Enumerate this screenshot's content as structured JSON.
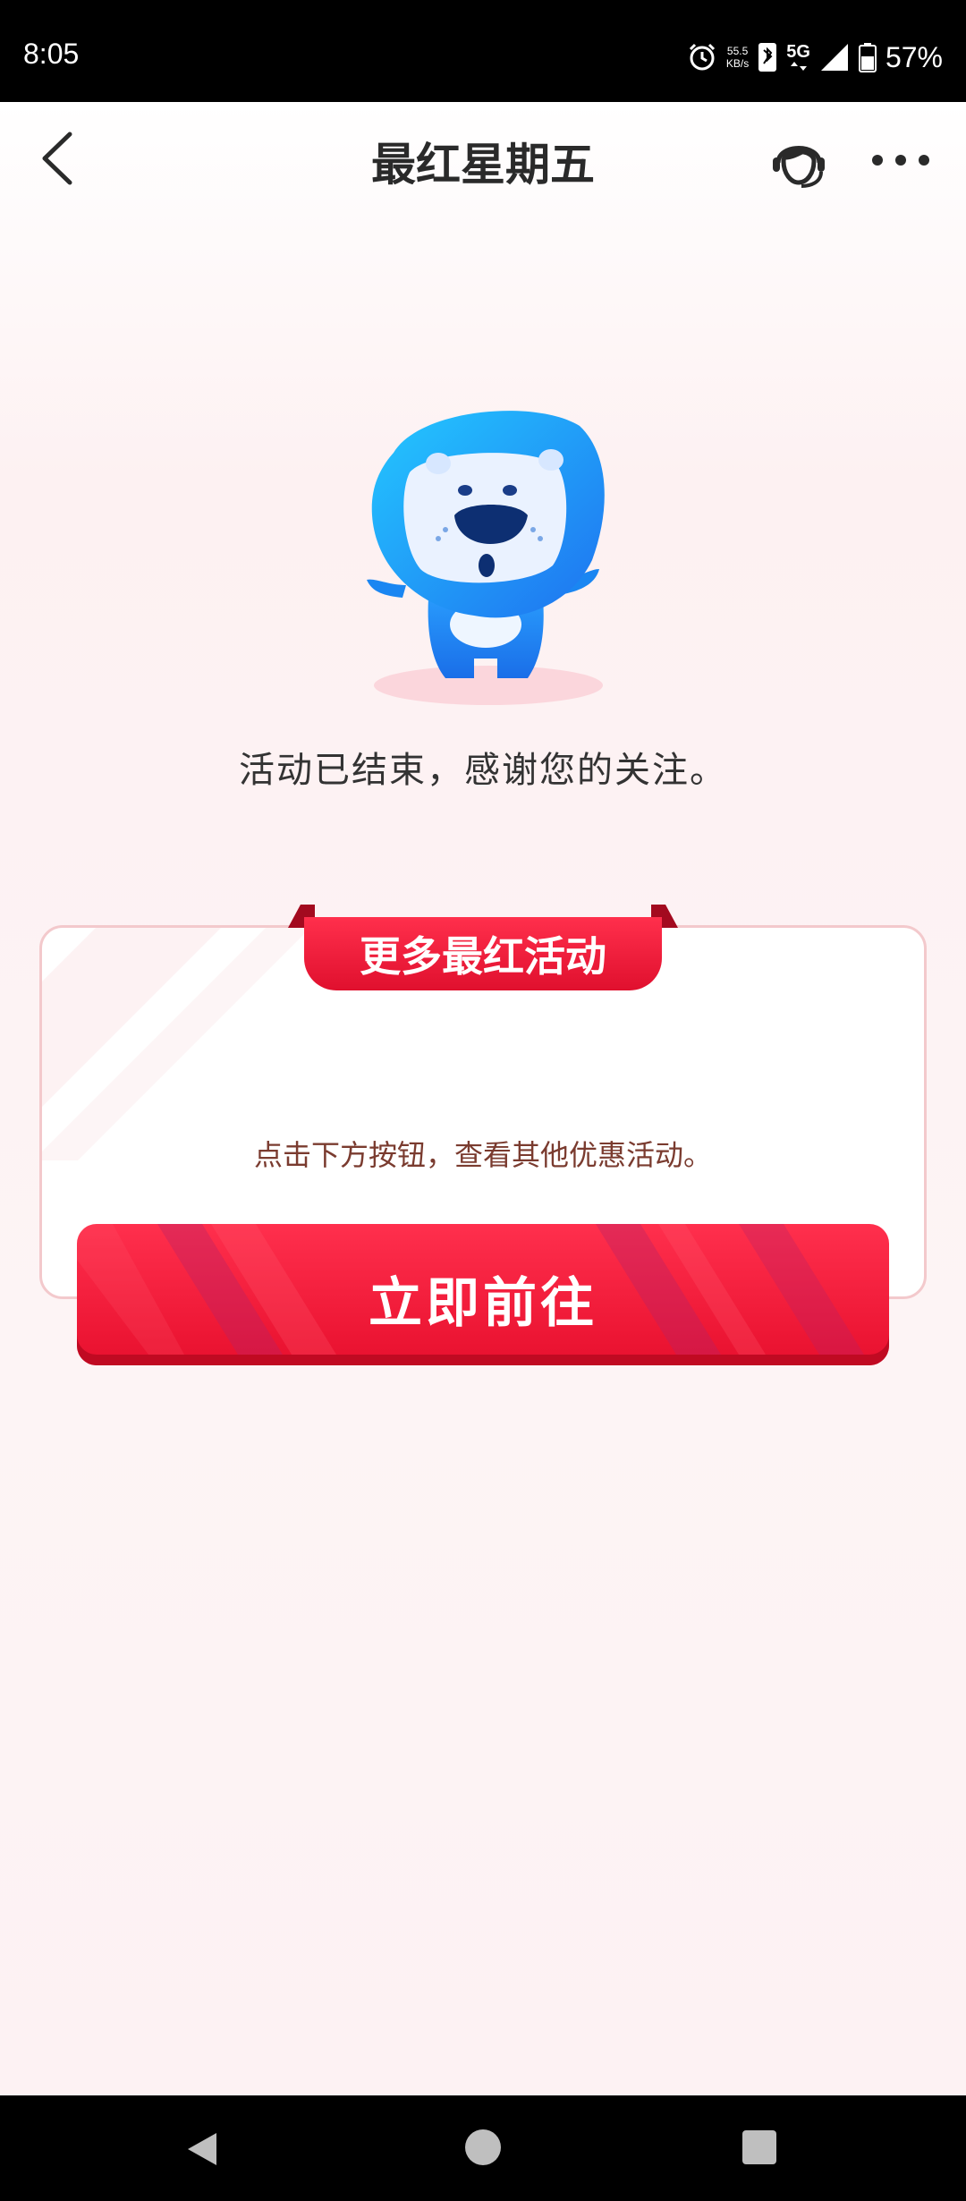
{
  "status_bar": {
    "time": "8:05",
    "net_speed_value": "55.5",
    "net_speed_unit": "KB/s",
    "network": "5G",
    "battery": "57%"
  },
  "header": {
    "title": "最红星期五"
  },
  "message": "活动已结束，感谢您的关注。",
  "card": {
    "ribbon_title": "更多最红活动",
    "subtitle": "点击下方按钮，查看其他优惠活动。",
    "button_label": "立即前往"
  },
  "colors": {
    "brand_red": "#e8102e",
    "mascot_blue": "#1f8dff"
  }
}
